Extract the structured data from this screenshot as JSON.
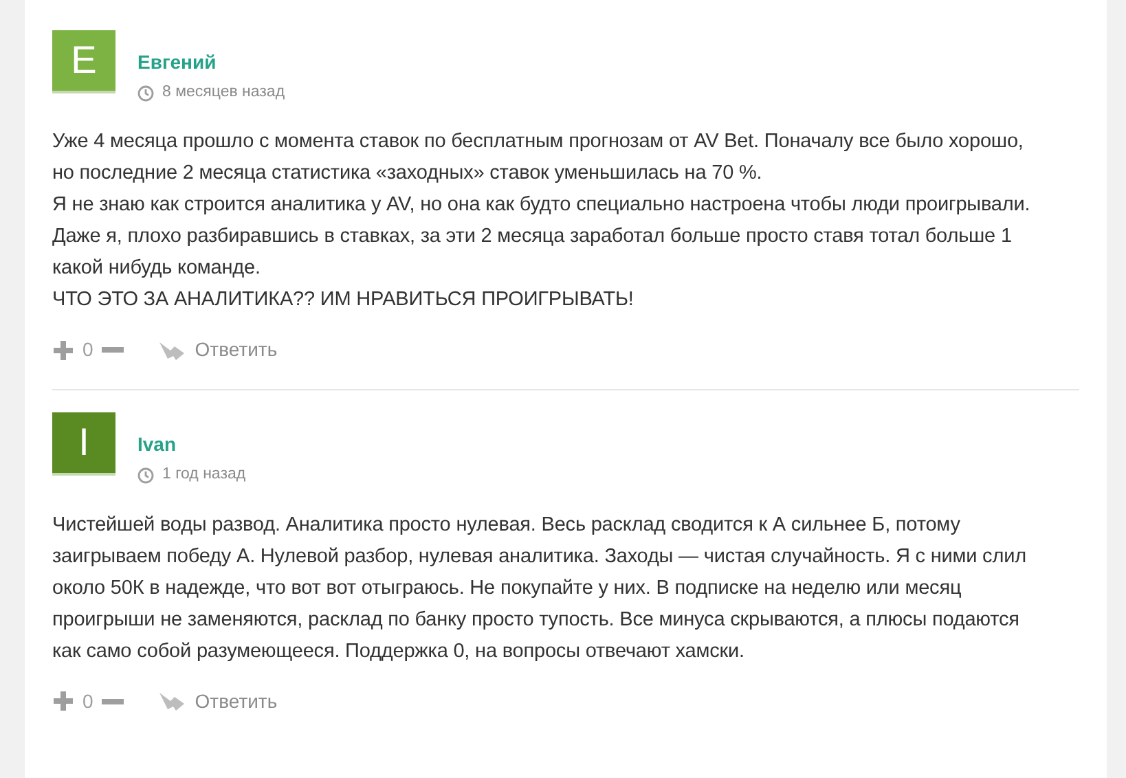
{
  "comments": [
    {
      "initial": "E",
      "color": "#7cb342",
      "author": "Евгений",
      "time": "8 месяцев назад",
      "paragraphs": [
        "Уже 4 месяца прошло с момента ставок по бесплатным прогнозам от AV Bet. Поначалу все было хорошо, но последние 2 месяца статистика «заходных» ставок уменьшилась на 70 %.",
        "Я не знаю как строится аналитика у AV, но она как будто специально настроена чтобы люди проигрывали.",
        "Даже я, плохо разбиравшись в ставках, за эти 2 месяца заработал больше просто ставя тотал больше 1 какой нибудь команде.",
        "ЧТО ЭТО ЗА АНАЛИТИКА?? ИМ НРАВИТЬСЯ ПРОИГРЫВАТЬ!"
      ],
      "votes": "0",
      "reply": "Ответить"
    },
    {
      "initial": "I",
      "color": "#5a8a22",
      "author": "Ivan",
      "time": "1 год назад",
      "paragraphs": [
        "Чистейшей воды развод. Аналитика просто нулевая. Весь расклад сводится к А сильнее Б, потому заигрываем победу А. Нулевой разбор, нулевая аналитика. Заходы — чистая случайность. Я с ними слил около 50К в надежде, что вот вот отыграюсь. Не покупайте у них. В подписке на неделю или месяц проигрыши не заменяются, расклад по банку просто тупость. Все минуса скрываются, а плюсы подаются как само собой разумеющееся. Поддержка 0, на вопросы отвечают хамски."
      ],
      "votes": "0",
      "reply": "Ответить"
    }
  ]
}
